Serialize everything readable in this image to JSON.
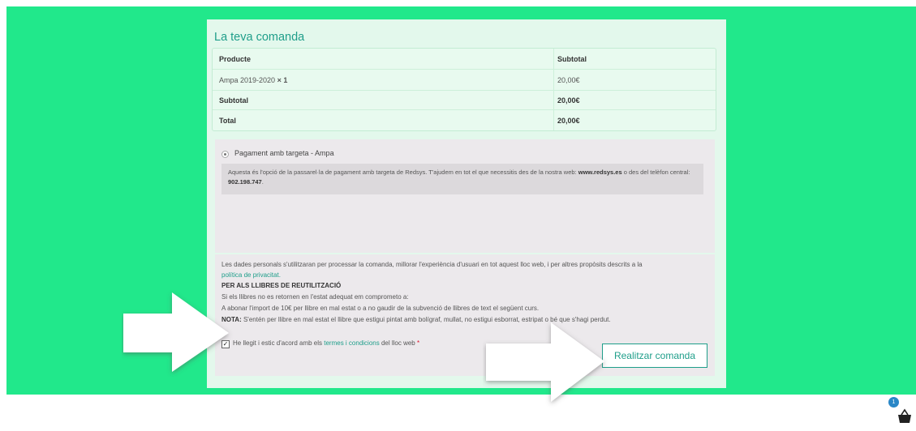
{
  "order": {
    "title": "La teva comanda",
    "col_product": "Producte",
    "col_subtotal": "Subtotal",
    "rows": [
      {
        "product": "Ampa 2019-2020",
        "qty": "× 1",
        "subtotal": "20,00€"
      },
      {
        "product": "Subtotal",
        "subtotal": "20,00€"
      },
      {
        "product": "Total",
        "subtotal": "20,00€"
      }
    ]
  },
  "payment": {
    "method_label": "Pagament amb targeta - Ampa",
    "desc_part1": "Aquesta és l'opció de la passarel·la de pagament amb targeta de Redsys. T'ajudem en tot el que necessitis des de la nostra web: ",
    "desc_web": "www.redsys.es",
    "desc_part2": " o des del telèfon central: ",
    "desc_phone": "902.198.747",
    "desc_end": "."
  },
  "info": {
    "privacy_text": "Les dades personals s'utilitzaran per processar la comanda, millorar l'experiència d'usuari en tot aquest lloc web, i per altres propòsits descrits a la",
    "privacy_link": "política de privacitat.",
    "reuse_heading": "PER ALS LLIBRES DE REUTILITZACIÓ",
    "reuse_line1": "Si els llibres no es retornen en l'estat adequat em comprometo a:",
    "reuse_line2": "A abonar l'import de 10€ per llibre en mal estat o a no gaudir de la subvenció de llibres de text el següent curs.",
    "note_label": "NOTA:",
    "note_text": " S'entén per llibre en mal estat el llibre que estigui pintat amb bolígraf, mullat, no estigui esborrat, estripat o bé que s'hagi perdut.",
    "terms_pre": "He llegit i estic d'acord amb els ",
    "terms_link": "termes i condicions",
    "terms_post": " del lloc web ",
    "terms_required": "*"
  },
  "submit_label": "Realitzar comanda",
  "cart": {
    "count": "1"
  },
  "colors": {
    "background": "#21e88b",
    "accent": "#1f9e8a",
    "badge": "#2a87c7"
  }
}
